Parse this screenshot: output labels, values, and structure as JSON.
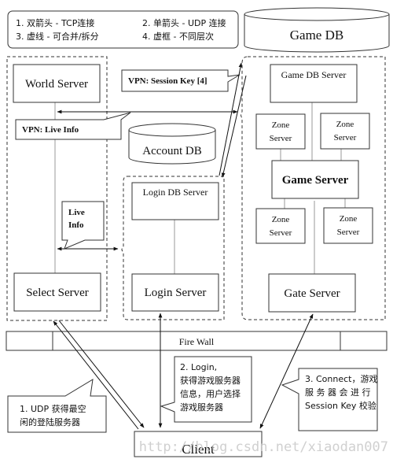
{
  "legend": {
    "items": [
      "1. 双箭头 - TCP连接",
      "2. 单箭头 - UDP 连接",
      "3. 虚线 - 可合并/拆分",
      "4. 虚框 - 不同层次"
    ]
  },
  "databases": {
    "game_db": "Game DB",
    "account_db": "Account DB"
  },
  "servers": {
    "world": "World Server",
    "select": "Select Server",
    "login_db": "Login DB Server",
    "login": "Login Server",
    "game_db_server": "Game DB Server",
    "game": "Game Server",
    "gate": "Gate Server",
    "zone": [
      "Zone",
      "Server"
    ]
  },
  "callouts": {
    "session_key": "VPN: Session Key [4]",
    "live_info_vpn": "VPN: Live Info",
    "live_info": [
      "Live",
      "Info"
    ],
    "step1": [
      "1. UDP 获得最空",
      "闲的登陆服务器"
    ],
    "step2": [
      "2. Login,",
      "获得游戏服务器",
      "信息，用户选择",
      "游戏服务器"
    ],
    "step3": [
      "3. Connect，游戏",
      "服 务 器 会 进 行",
      "Session Key 校验"
    ]
  },
  "firewall": "Fire Wall",
  "client": "Client",
  "watermark": "http://blog.csdn.net/xiaodan007"
}
